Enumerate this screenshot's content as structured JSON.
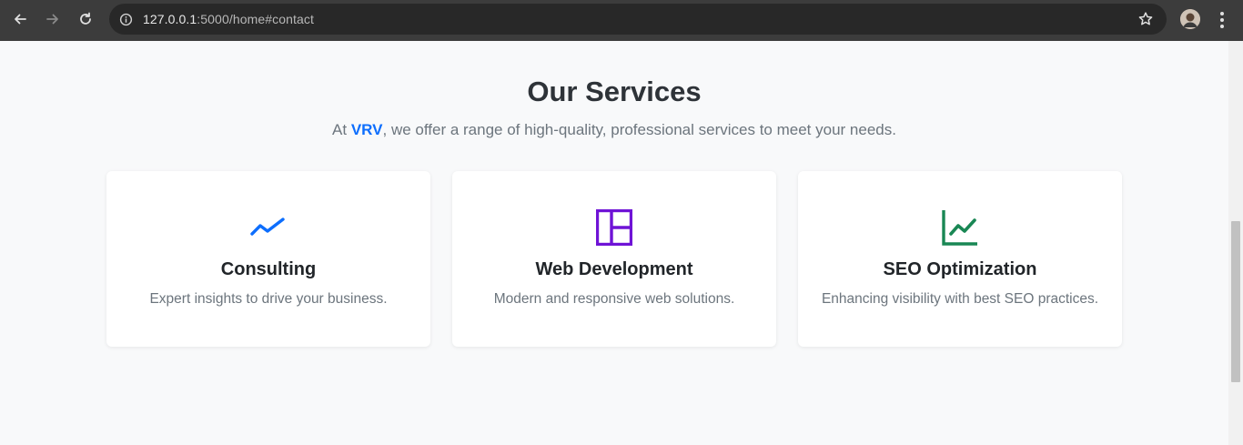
{
  "browser": {
    "url_host": "127.0.0.1",
    "url_rest": ":5000/home#contact"
  },
  "services": {
    "title": "Our Services",
    "subtitle_prefix": "At ",
    "brand": "VRV",
    "subtitle_suffix": ", we offer a range of high-quality, professional services to meet your needs.",
    "cards": [
      {
        "name": "Consulting",
        "description": "Expert insights to drive your business.",
        "icon": "trend-line-icon",
        "color": "#0d6efd"
      },
      {
        "name": "Web Development",
        "description": "Modern and responsive web solutions.",
        "icon": "layout-icon",
        "color": "#6f13d6"
      },
      {
        "name": "SEO Optimization",
        "description": "Enhancing visibility with best SEO practices.",
        "icon": "line-chart-icon",
        "color": "#198754"
      }
    ]
  }
}
